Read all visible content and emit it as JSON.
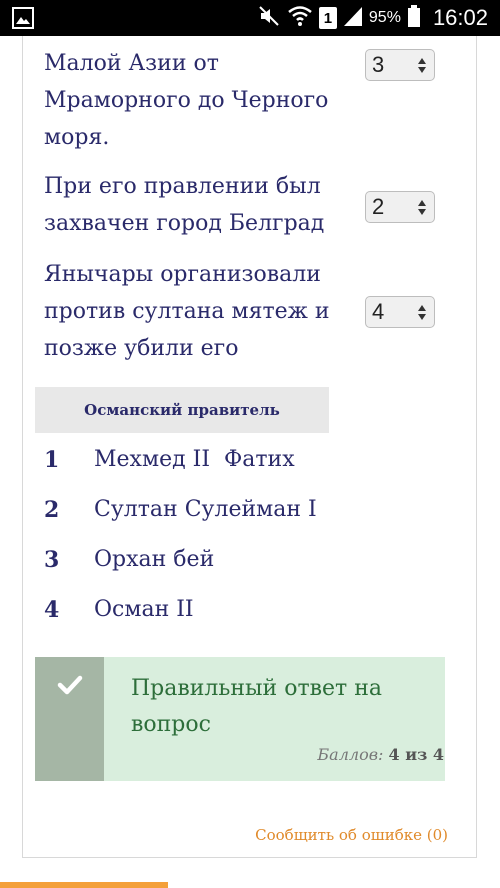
{
  "status_bar": {
    "battery_percent": "95%",
    "time": "16:02",
    "sim_label": "1"
  },
  "questions": [
    {
      "text_lines": [
        "Малой Азии от",
        "Мраморного до Черного",
        "моря."
      ],
      "selected": "3"
    },
    {
      "text_lines": [
        "При его правлении был",
        "захвачен город Белград"
      ],
      "selected": "2"
    },
    {
      "text_lines": [
        "Янычары организовали",
        "против султана мятеж и",
        "позже убили его"
      ],
      "selected": "4"
    }
  ],
  "rulers_table": {
    "header": "Османский правитель",
    "rows": [
      {
        "num": "1",
        "name": "Мехмед II  Фатих"
      },
      {
        "num": "2",
        "name": "Султан Сулейман I"
      },
      {
        "num": "3",
        "name": "Орхан бей"
      },
      {
        "num": "4",
        "name": "Осман II"
      }
    ]
  },
  "feedback": {
    "message": "Правильный ответ на вопрос",
    "score_label": "Баллов:",
    "score_value": "4 из 4",
    "icon": "check-icon"
  },
  "report_link": "Сообщить об ошибке (0)",
  "colors": {
    "text": "#2a2a6a",
    "feedback_bg": "#d9eedd",
    "feedback_text": "#2d6e3a",
    "link": "#e08a2a"
  }
}
